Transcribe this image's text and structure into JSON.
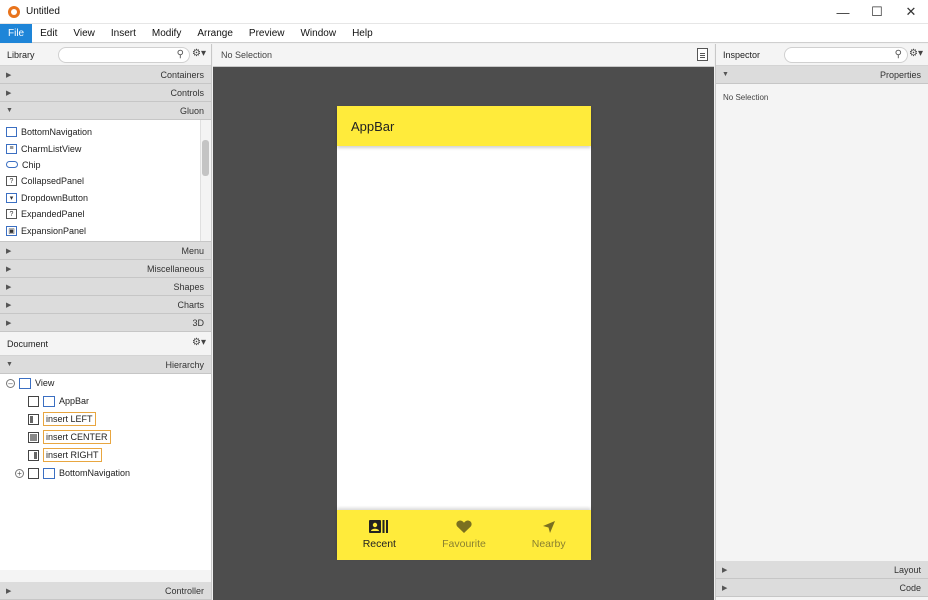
{
  "window": {
    "title": "Untitled",
    "controls": {
      "minimize": "—",
      "maximize": "☐",
      "close": "✕"
    }
  },
  "menubar": [
    "File",
    "Edit",
    "View",
    "Insert",
    "Modify",
    "Arrange",
    "Preview",
    "Window",
    "Help"
  ],
  "library": {
    "title": "Library",
    "sections_top": [
      "Containers",
      "Controls",
      "Gluon"
    ],
    "gluon_items": [
      "BottomNavigation",
      "CharmListView",
      "Chip",
      "CollapsedPanel",
      "DropdownButton",
      "ExpandedPanel",
      "ExpansionPanel"
    ],
    "sections_bottom": [
      "Menu",
      "Miscellaneous",
      "Shapes",
      "Charts",
      "3D"
    ]
  },
  "document": {
    "title": "Document",
    "hierarchy_label": "Hierarchy",
    "tree": {
      "root": "View",
      "appbar": "AppBar",
      "insert_left": "insert LEFT",
      "insert_center": "insert CENTER",
      "insert_right": "insert RIGHT",
      "bottom_nav": "BottomNavigation"
    },
    "controller_label": "Controller"
  },
  "canvas": {
    "selection": "No Selection",
    "appbar_title": "AppBar",
    "nav": [
      {
        "label": "Recent",
        "icon": "contacts-icon",
        "active": true
      },
      {
        "label": "Favourite",
        "icon": "heart-icon",
        "active": false
      },
      {
        "label": "Nearby",
        "icon": "navigation-icon",
        "active": false
      }
    ],
    "colors": {
      "accent": "#ffeb3b",
      "canvas_bg": "#4d4d4d",
      "menu_active": "#1e85d8"
    }
  },
  "inspector": {
    "title": "Inspector",
    "properties_label": "Properties",
    "no_selection": "No Selection",
    "layout_label": "Layout",
    "code_label": "Code"
  }
}
